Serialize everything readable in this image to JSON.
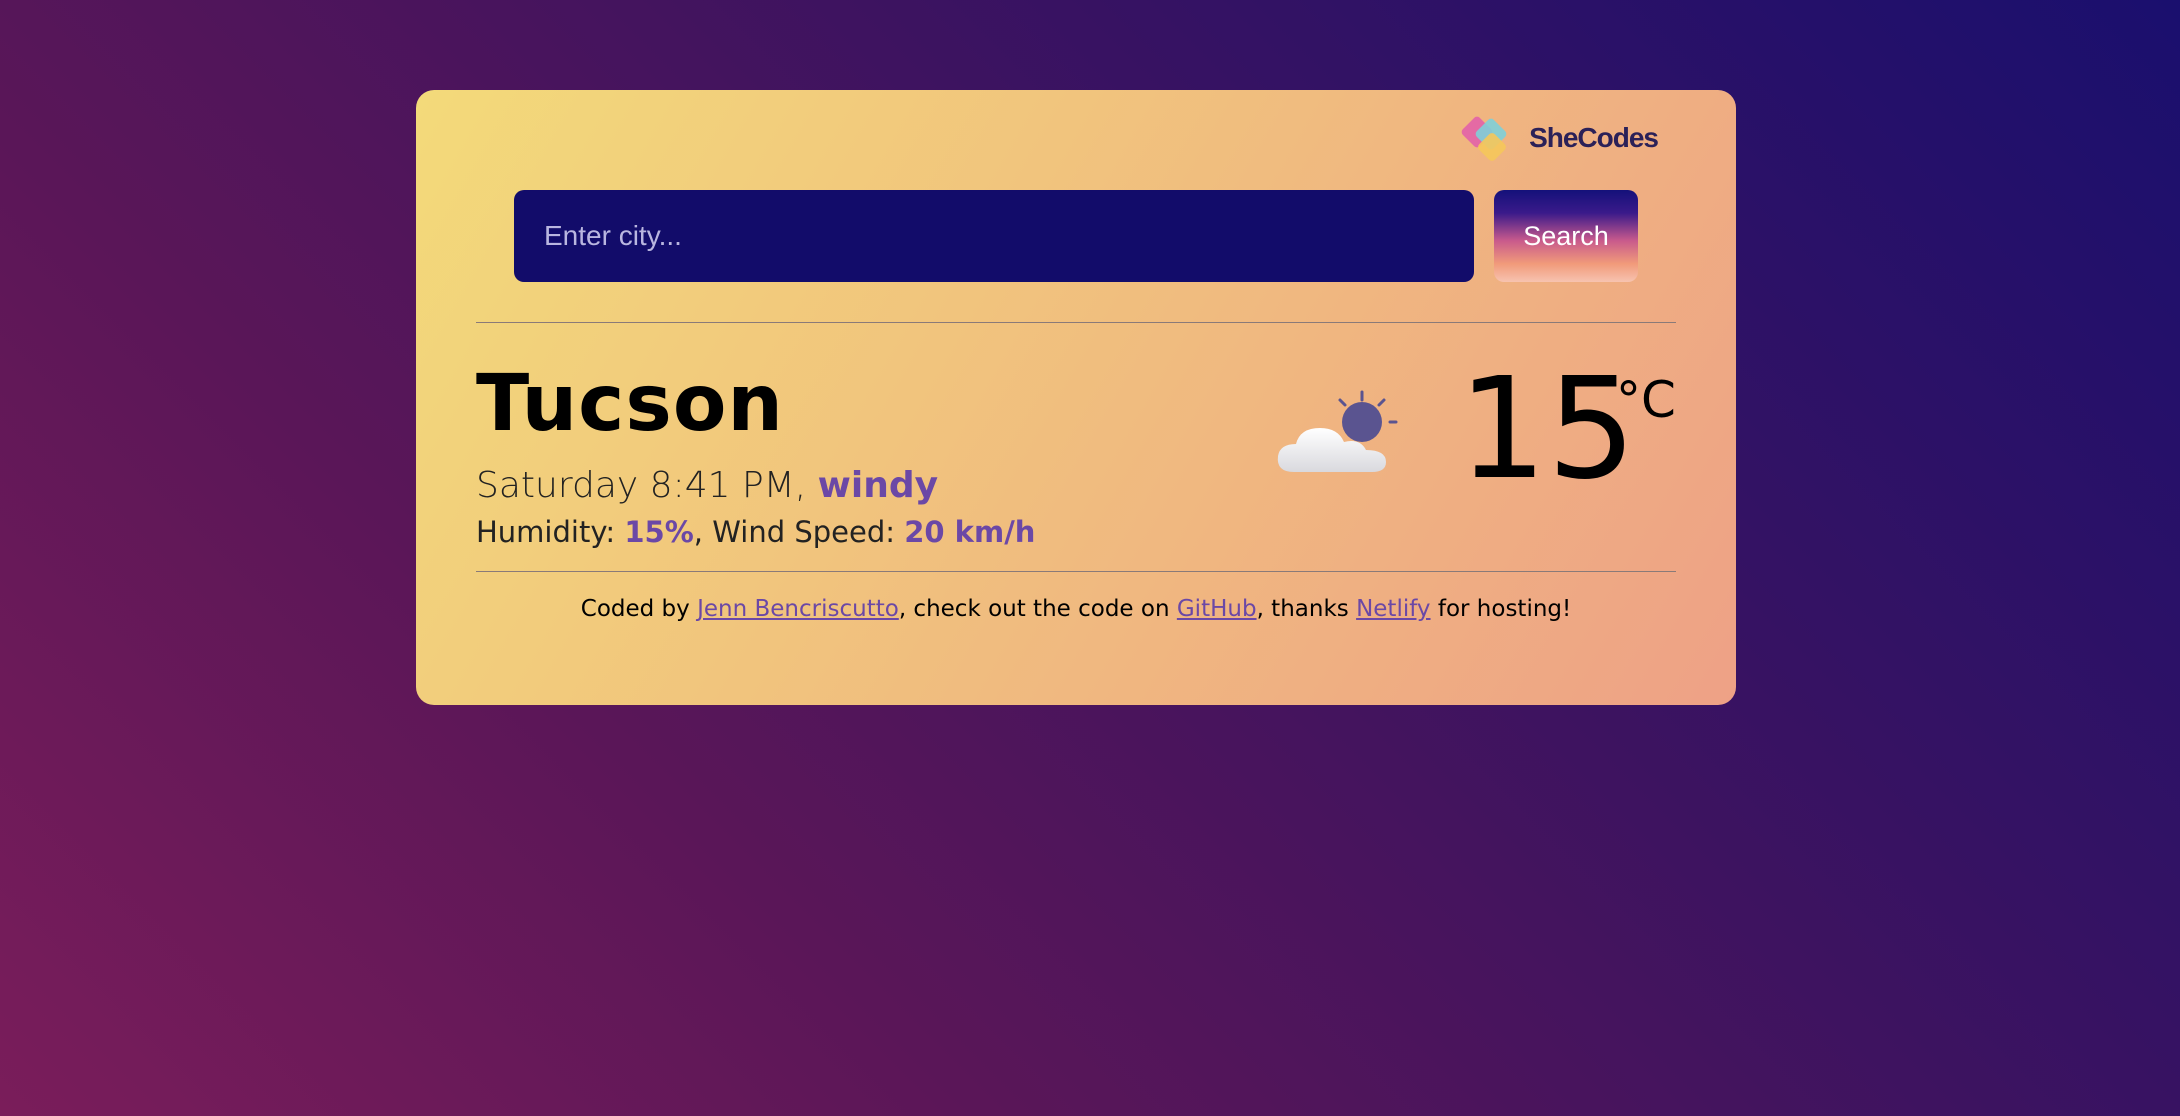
{
  "brand": {
    "logo_text": "SheCodes"
  },
  "search": {
    "placeholder": "Enter city...",
    "button_label": "Search"
  },
  "weather": {
    "city": "Tucson",
    "day_time": "Saturday 8:41 PM",
    "separator": ", ",
    "description": "windy",
    "humidity_label": "Humidity: ",
    "humidity_value": "15%",
    "wind_label": ", Wind Speed: ",
    "wind_value": "20 km/h",
    "temperature": "15",
    "unit": "°C",
    "icon": "partly-cloudy-night-icon"
  },
  "footer": {
    "prefix": "Coded by ",
    "author": "Jenn Bencriscutto",
    "middle": ", check out the code on ",
    "repo_link": "GitHub",
    "thanks": ", thanks ",
    "host_link": "Netlify",
    "suffix": " for hosting!"
  },
  "colors": {
    "background_gradient": [
      "#1a0f6e",
      "#7a1d5a"
    ],
    "card_gradient": [
      "#f3da7a",
      "#eea186"
    ],
    "input_background": "#120c6a",
    "accent": "#6b48a6"
  }
}
